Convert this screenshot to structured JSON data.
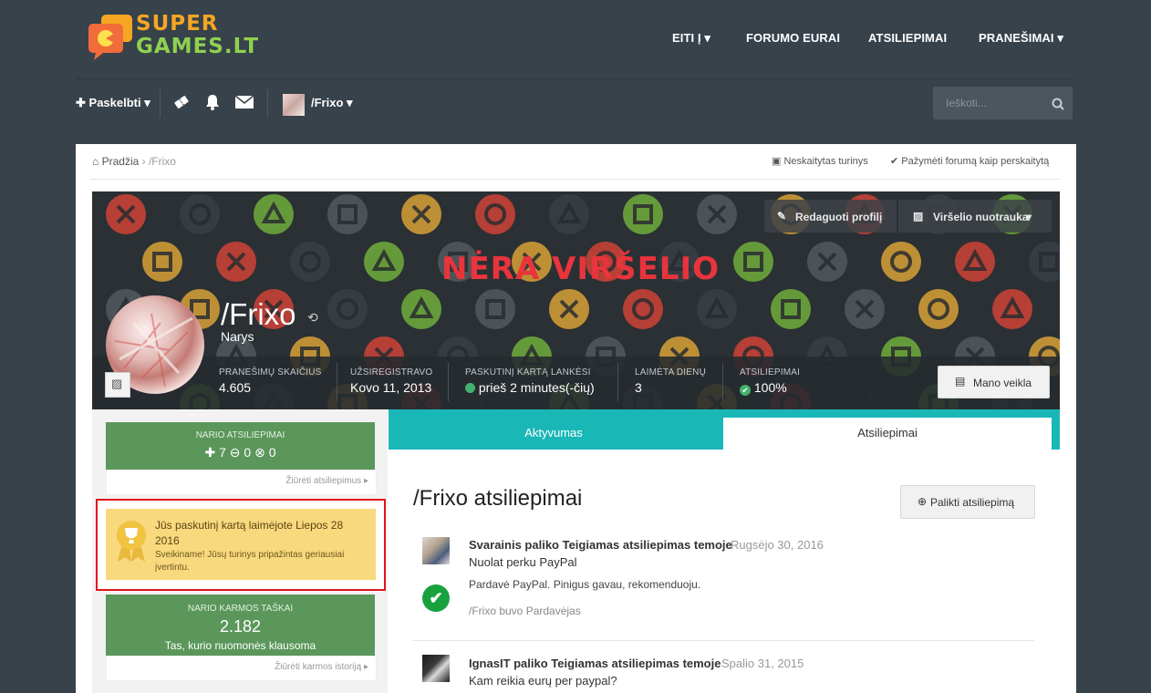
{
  "site": {
    "logo_top": "SUPER",
    "logo_bottom": "GAMES.LT"
  },
  "nav": {
    "items": [
      "EITI Į",
      "FORUMO EURAI",
      "ATSILIEPIMAI",
      "PRANEŠIMAI"
    ]
  },
  "userbar": {
    "post_label": "Paskelbti",
    "username": "/Frixo",
    "search_placeholder": "Ieškoti..."
  },
  "breadcrumb": {
    "home": "Pradžia",
    "current": "/Frixo",
    "unread": "Neskaitytas turinys",
    "mark_read": "Pažymėti forumą kaip perskaitytą"
  },
  "cover": {
    "no_cover_text": "NĖRA VIRŠELIO",
    "edit_profile": "Redaguoti profilį",
    "cover_photo": "Viršelio nuotrauka"
  },
  "profile": {
    "name": "/Frixo",
    "group": "Narys",
    "stats": [
      {
        "label": "PRANEŠIMŲ SKAIČIUS",
        "value": "4.605"
      },
      {
        "label": "UŽSIREGISTRAVO",
        "value": "Kovo 11, 2013"
      },
      {
        "label": "PASKUTINĮ KARTĄ LANKĖSI",
        "value": "prieš 2 minutes(-čių)"
      },
      {
        "label": "LAIMĖTA DIENŲ",
        "value": "3"
      },
      {
        "label": "ATSILIEPIMAI",
        "value": "100%"
      }
    ],
    "activity_btn": "Mano veikla"
  },
  "sidebar": {
    "feedback_title": "NARIO ATSILIEPIMAI",
    "feedback_pos": "7",
    "feedback_neu": "0",
    "feedback_neg": "0",
    "feedback_link": "Žiūrėti atsiliepimus",
    "award_title": "Jūs paskutinį kartą laimėjote Liepos 28 2016",
    "award_text": "Sveikiname! Jūsų turinys pripažintas geriausiai įvertintu.",
    "karma_title": "NARIO KARMOS TAŠKAI",
    "karma_value": "2.182",
    "karma_sub": "Tas, kurio nuomonės klausoma",
    "karma_link": "Žiūrėti karmos istoriją"
  },
  "tabs": {
    "activity": "Aktyvumas",
    "feedback": "Atsiliepimai"
  },
  "feedback": {
    "heading": "/Frixo atsiliepimai",
    "leave_btn": "Palikti atsiliepimą",
    "entries": [
      {
        "author": "Svarainis paliko Teigiamas atsiliepimas temoje",
        "date": "Rugsėjo 30, 2016",
        "topic": "Nuolat perku PayPal",
        "comment": "Pardavė PayPal. Pinigus gavau, rekomenduoju.",
        "role": "/Frixo buvo Pardavėjas"
      },
      {
        "author": "IgnasIT paliko Teigiamas atsiliepimas temoje",
        "date": "Spalio 31, 2015",
        "topic": "Kam reikia eurų per paypal?"
      }
    ]
  },
  "colors": {
    "accent": "#1ab7b7",
    "positive": "#5b975b",
    "award_bg": "#f9d97e",
    "highlight": "#e0141e"
  }
}
